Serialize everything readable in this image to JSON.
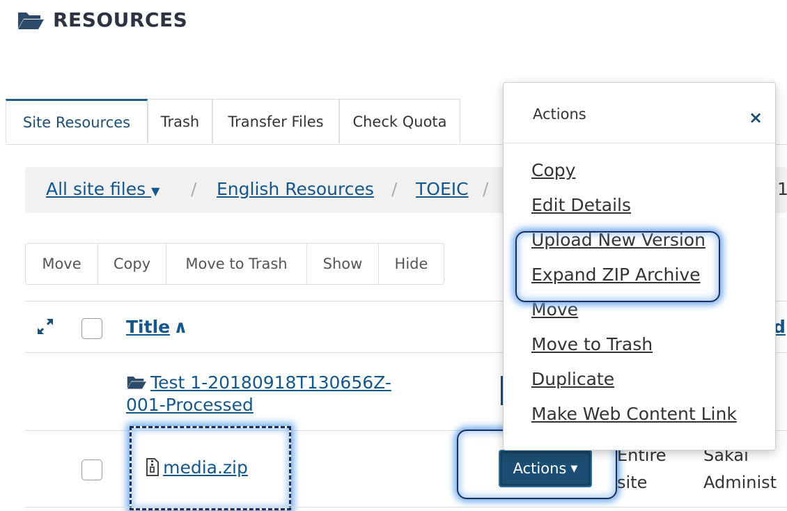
{
  "header": {
    "title": "RESOURCES"
  },
  "tabs": [
    {
      "label": "Site Resources"
    },
    {
      "label": "Trash"
    },
    {
      "label": "Transfer Files"
    },
    {
      "label": "Check Quota"
    }
  ],
  "breadcrumb": {
    "items": [
      "All site files",
      "English Resources",
      "TOEIC"
    ],
    "separator": "/",
    "overflow_char": "1"
  },
  "toolbar": {
    "buttons": [
      "Move",
      "Copy",
      "Move to Trash",
      "Show",
      "Hide"
    ]
  },
  "table": {
    "title_header": "Title",
    "sort_indicator": "∧",
    "partial_header": "d",
    "rows": [
      {
        "name_line1": "Test 1-20180918T130656Z-",
        "name_line2": "001-Processed",
        "type": "folder"
      },
      {
        "name": "media.zip",
        "type": "zip",
        "actions_label": "Actions",
        "access_line1": "Entire",
        "access_line2": "site",
        "owner_line1": "Sakai",
        "owner_line2": "Administ"
      }
    ]
  },
  "popover": {
    "title": "Actions",
    "close": "×",
    "items": [
      "Copy",
      "Edit Details",
      "Upload New Version",
      "Expand ZIP Archive",
      "Move",
      "Move to Trash",
      "Duplicate",
      "Make Web Content Link"
    ]
  },
  "colors": {
    "link": "#15568b",
    "actions_button": "#1c4e73",
    "highlight_glow": "#5fa0eb",
    "highlight_border": "#1a2f5a"
  },
  "icons": [
    "folder-open-icon",
    "expand-icon",
    "zip-file-icon",
    "caret-down-icon",
    "close-icon"
  ]
}
